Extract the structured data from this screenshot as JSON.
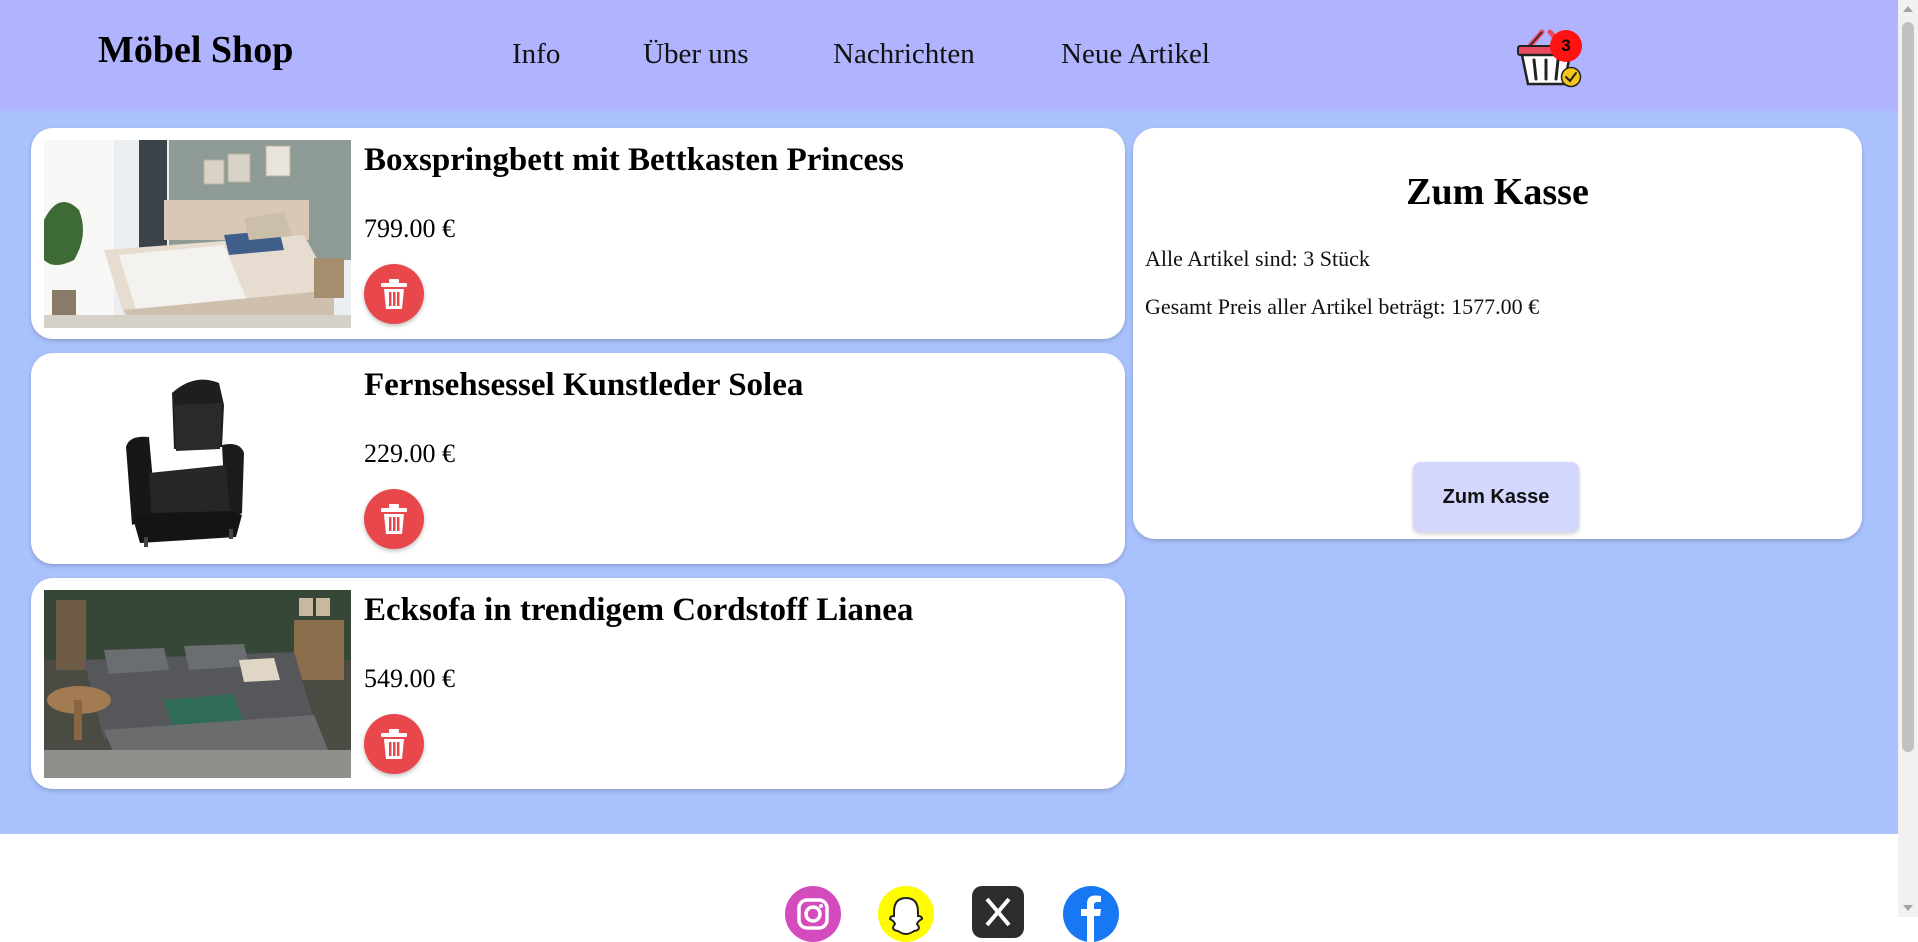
{
  "header": {
    "logo": "Möbel Shop",
    "nav": [
      "Info",
      "Über uns",
      "Nachrichten",
      "Neue Artikel"
    ],
    "cart_count": "3",
    "cart_icon": "shopping-basket-icon"
  },
  "cart_items": [
    {
      "title": "Boxspringbett mit Bettkasten Princess",
      "price": "799.00 €",
      "image": "bed-photo"
    },
    {
      "title": "Fernsehsessel Kunstleder Solea",
      "price": "229.00 €",
      "image": "armchair-photo"
    },
    {
      "title": "Ecksofa in trendigem Cordstoff Lianea",
      "price": "549.00 €",
      "image": "sofa-photo"
    }
  ],
  "checkout": {
    "title": "Zum Kasse",
    "items_line": "Alle Artikel sind: 3 Stück",
    "total_line": "Gesamt Preis aller Artikel beträgt: 1577.00 €",
    "button": "Zum Kasse"
  },
  "social": [
    {
      "name": "instagram-icon",
      "color": "#d34bbd"
    },
    {
      "name": "snapchat-icon",
      "color": "#fffc00"
    },
    {
      "name": "x-icon",
      "color": "#2d2d2d"
    },
    {
      "name": "facebook-icon",
      "color": "#1877f2"
    }
  ],
  "colors": {
    "header_bg": "#b0b3fd",
    "main_bg": "#a9c2fd",
    "delete_button": "#e8484c",
    "checkout_button": "#d3d6fd",
    "cart_badge": "#ff1212"
  }
}
